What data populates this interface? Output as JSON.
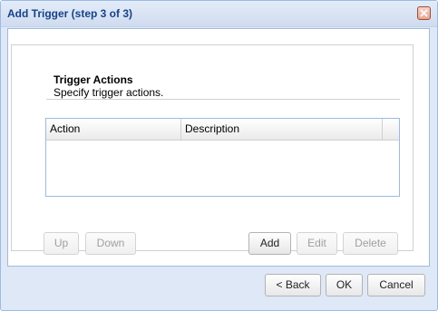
{
  "window": {
    "title": "Add Trigger (step 3 of 3)",
    "close_icon": "close-icon",
    "accent_color": "#15428b",
    "close_color": "#e9a58e"
  },
  "section": {
    "title": "Trigger Actions",
    "subtitle": "Specify trigger actions."
  },
  "grid": {
    "columns": [
      "Action",
      "Description",
      ""
    ],
    "rows": []
  },
  "grid_buttons": {
    "up": "Up",
    "down": "Down",
    "add": "Add",
    "edit": "Edit",
    "delete": "Delete"
  },
  "footer": {
    "back": "< Back",
    "ok": "OK",
    "cancel": "Cancel"
  }
}
